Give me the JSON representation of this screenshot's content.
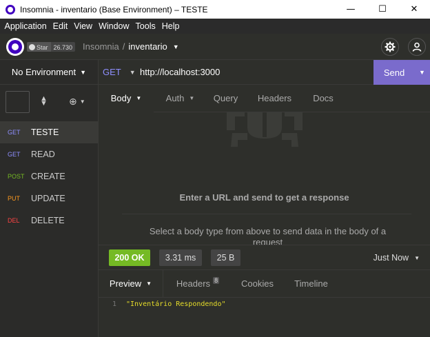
{
  "window": {
    "title": "Insomnia - inventario (Base Environment) – TESTE",
    "minimize": "—",
    "maximize": "☐",
    "close": "✕"
  },
  "menu": [
    "Application",
    "Edit",
    "View",
    "Window",
    "Tools",
    "Help"
  ],
  "header": {
    "github_star_label": "Star",
    "github_star_count": "26.730",
    "org": "Insomnia",
    "separator": "/",
    "workspace": "inventario"
  },
  "sidebar": {
    "environment": "No Environment",
    "requests": [
      {
        "method": "GET",
        "name": "TESTE",
        "color": "#8f8fff",
        "active": true
      },
      {
        "method": "GET",
        "name": "READ",
        "color": "#8f8fff",
        "active": false
      },
      {
        "method": "POST",
        "name": "CREATE",
        "color": "#75ba24",
        "active": false
      },
      {
        "method": "PUT",
        "name": "UPDATE",
        "color": "#ff9a1f",
        "active": false
      },
      {
        "method": "DEL",
        "name": "DELETE",
        "color": "#ff4444",
        "active": false
      }
    ]
  },
  "url_bar": {
    "method": "GET",
    "url": "http://localhost:3000",
    "send_label": "Send"
  },
  "request_tabs": [
    {
      "label": "Body",
      "active": true,
      "has_caret": true
    },
    {
      "label": "Auth",
      "active": false,
      "has_caret": true
    },
    {
      "label": "Query",
      "active": false,
      "has_caret": false
    },
    {
      "label": "Headers",
      "active": false,
      "has_caret": false
    },
    {
      "label": "Docs",
      "active": false,
      "has_caret": false
    }
  ],
  "request_body": {
    "empty_main": "Enter a URL and send to get a response",
    "empty_sub": "Select a body type from above to send data in the body of a request"
  },
  "response": {
    "status": "200 OK",
    "time": "3.31 ms",
    "size": "25 B",
    "time_ago": "Just Now",
    "tabs": [
      {
        "label": "Preview",
        "active": true,
        "badge": ""
      },
      {
        "label": "Headers",
        "active": false,
        "badge": "8"
      },
      {
        "label": "Cookies",
        "active": false,
        "badge": ""
      },
      {
        "label": "Timeline",
        "active": false,
        "badge": ""
      }
    ],
    "body_lines": [
      {
        "line": "1",
        "text": "\"Inventário Respondendo\""
      }
    ]
  },
  "colors": {
    "accent": "#7a6bcc",
    "status_ok": "#75ba24",
    "get": "#8f8fff",
    "post": "#75ba24",
    "put": "#ff9a1f",
    "delete": "#ff4444"
  }
}
